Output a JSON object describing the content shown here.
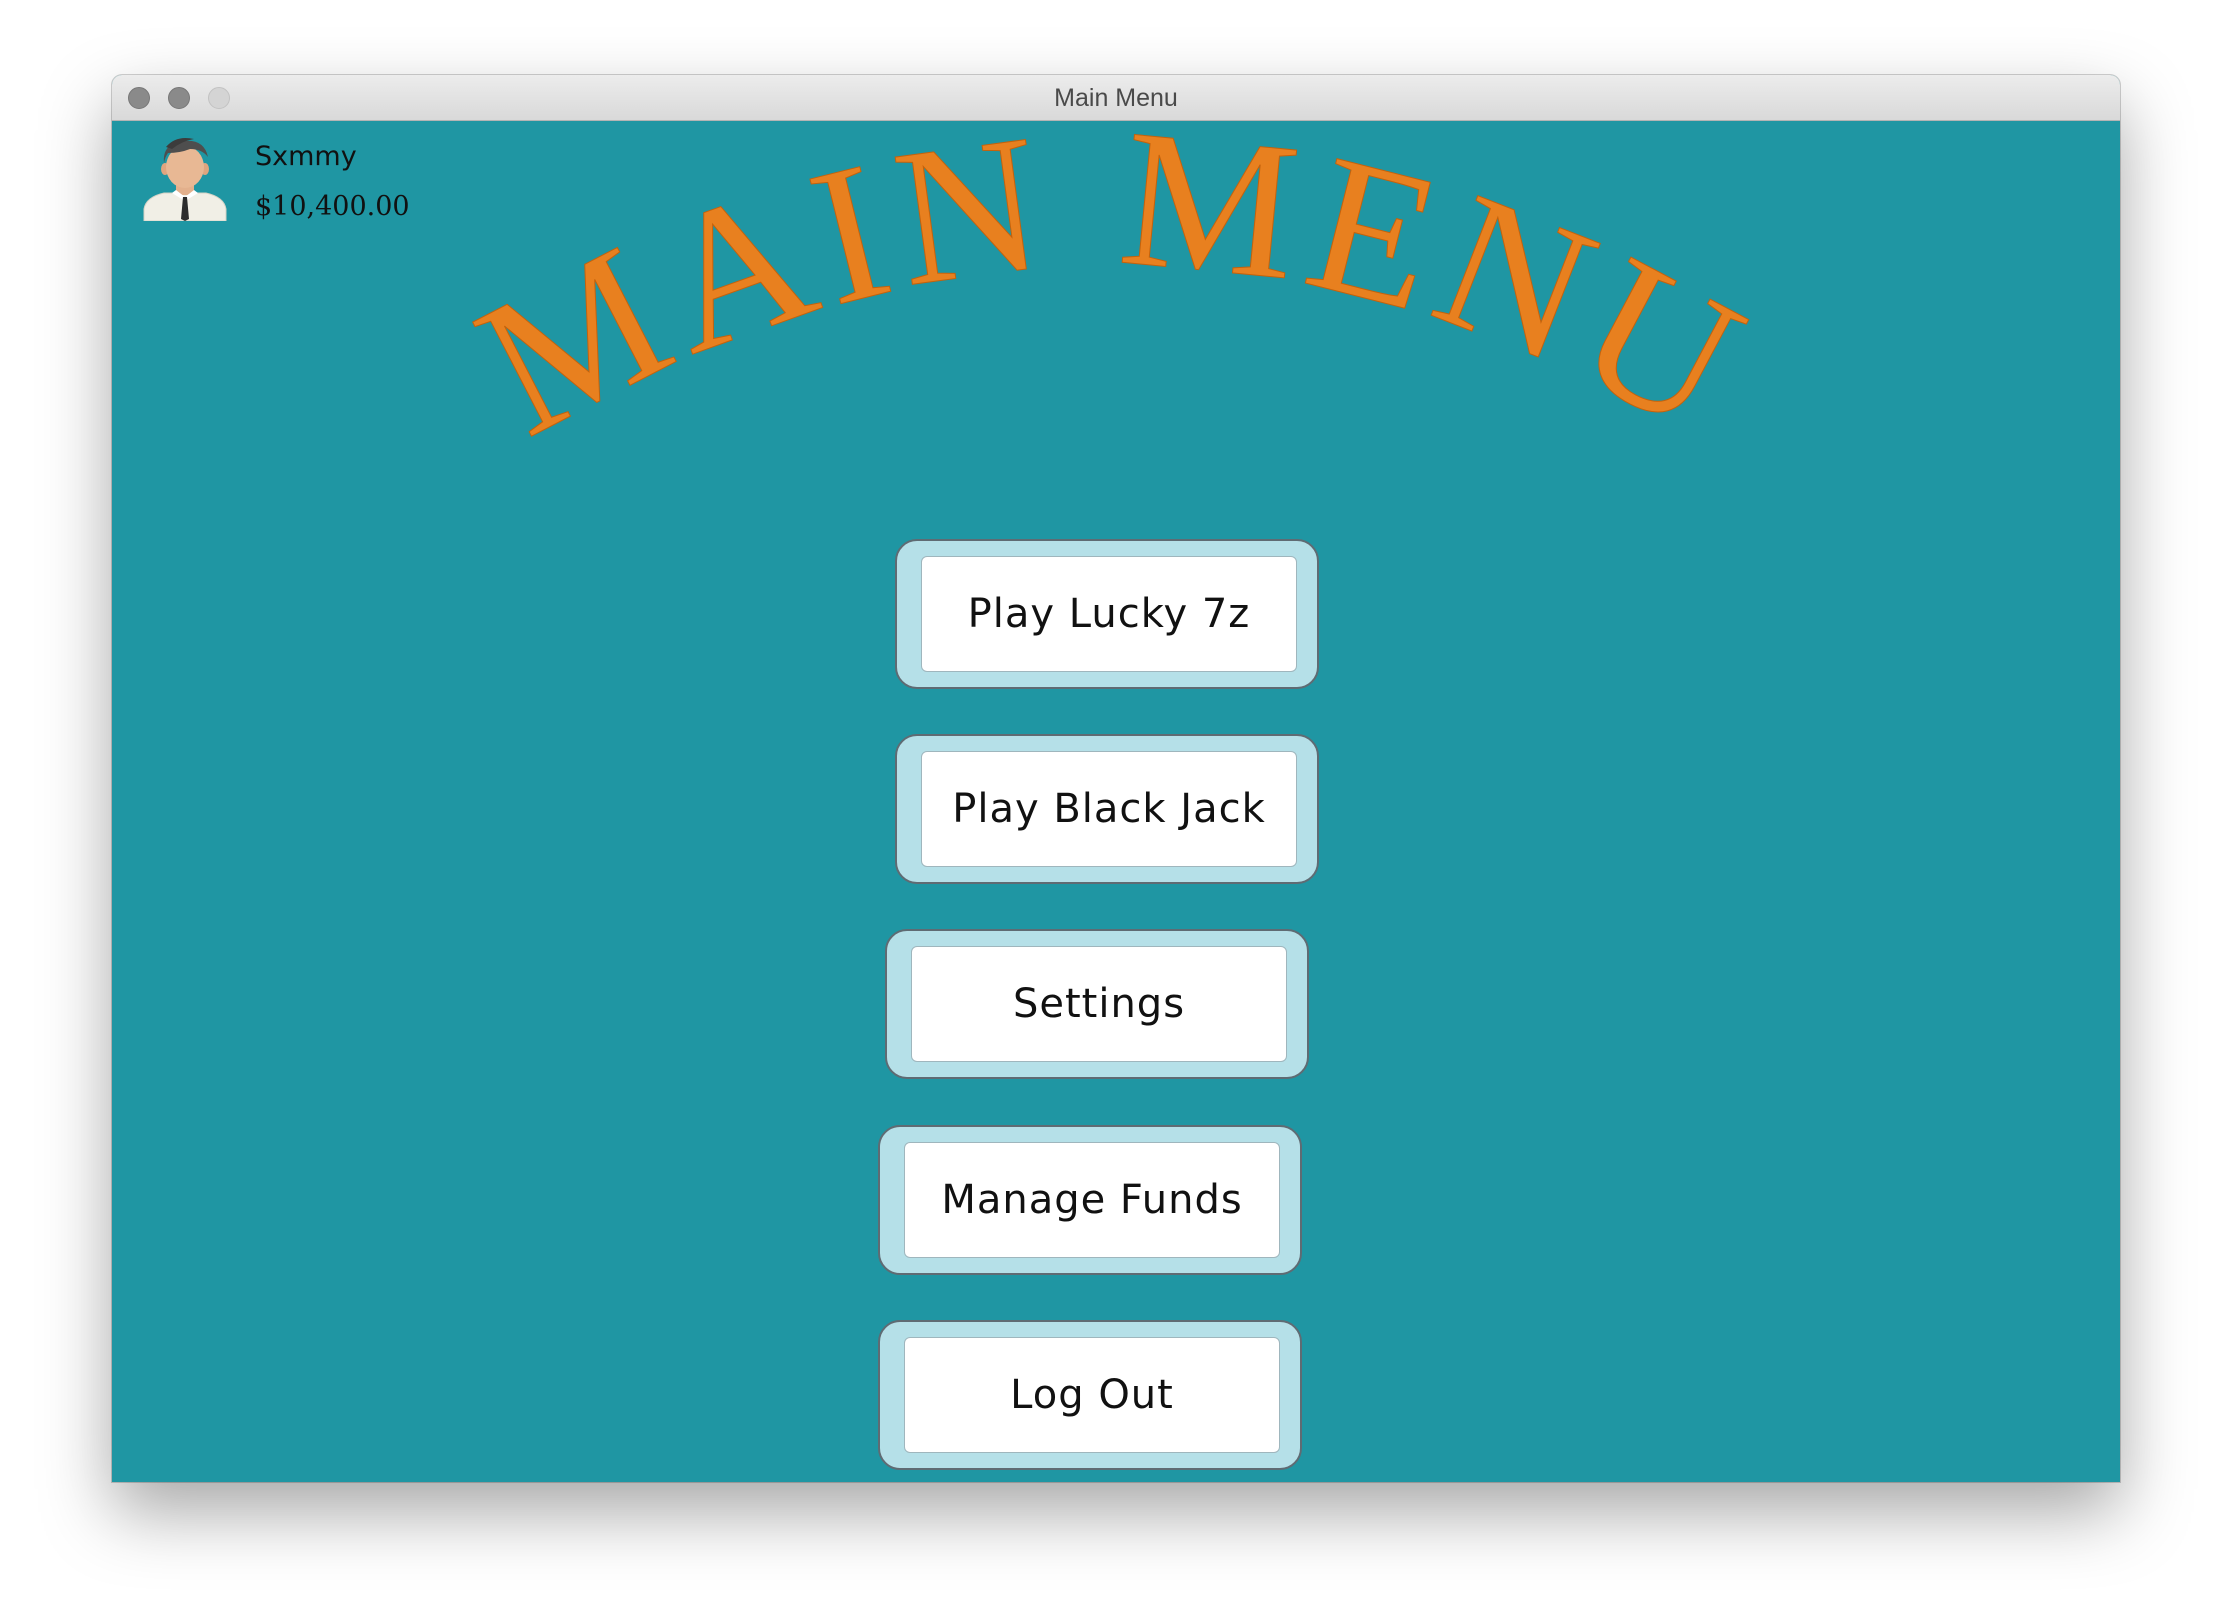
{
  "window": {
    "title": "Main Menu"
  },
  "user": {
    "name": "Sxmmy",
    "balance": "$10,400.00",
    "avatar_icon": "user-avatar-icon"
  },
  "header": {
    "title": "MAIN MENU",
    "color": "#e8801f"
  },
  "menu": {
    "buttons": [
      {
        "label": "Play Lucky 7z"
      },
      {
        "label": "Play Black Jack"
      },
      {
        "label": "Settings"
      },
      {
        "label": "Manage Funds"
      },
      {
        "label": "Log Out"
      }
    ]
  },
  "colors": {
    "background": "#1f96a3",
    "button_frame": "#b5e0e8",
    "button_face": "#ffffff"
  }
}
